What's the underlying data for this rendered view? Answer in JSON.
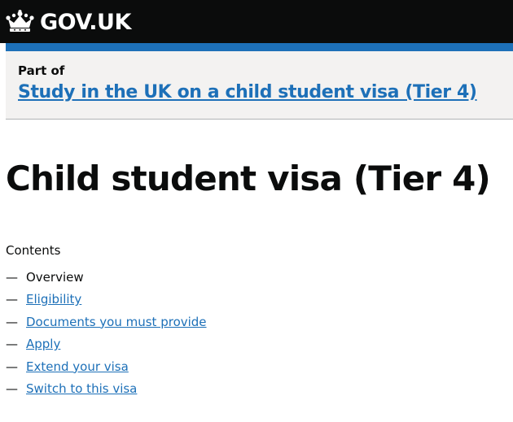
{
  "header": {
    "logo_text": "GOV.UK",
    "logo_icon": "crown-icon",
    "background_color": "#0b0c0c",
    "accent_bar_color": "#1d70b8"
  },
  "part_of": {
    "label": "Part of",
    "link_text": "Study in the UK on a child student visa (Tier 4)"
  },
  "page": {
    "title": "Child student visa (Tier 4)"
  },
  "contents": {
    "heading": "Contents",
    "dash": "—",
    "items": [
      {
        "label": "Overview",
        "current": true
      },
      {
        "label": "Eligibility",
        "current": false
      },
      {
        "label": "Documents you must provide",
        "current": false
      },
      {
        "label": "Apply",
        "current": false
      },
      {
        "label": "Extend your visa",
        "current": false
      },
      {
        "label": "Switch to this visa",
        "current": false
      }
    ]
  },
  "colors": {
    "link": "#1d70b8",
    "text": "#0b0c0c",
    "part_of_background": "#f3f2f1"
  }
}
